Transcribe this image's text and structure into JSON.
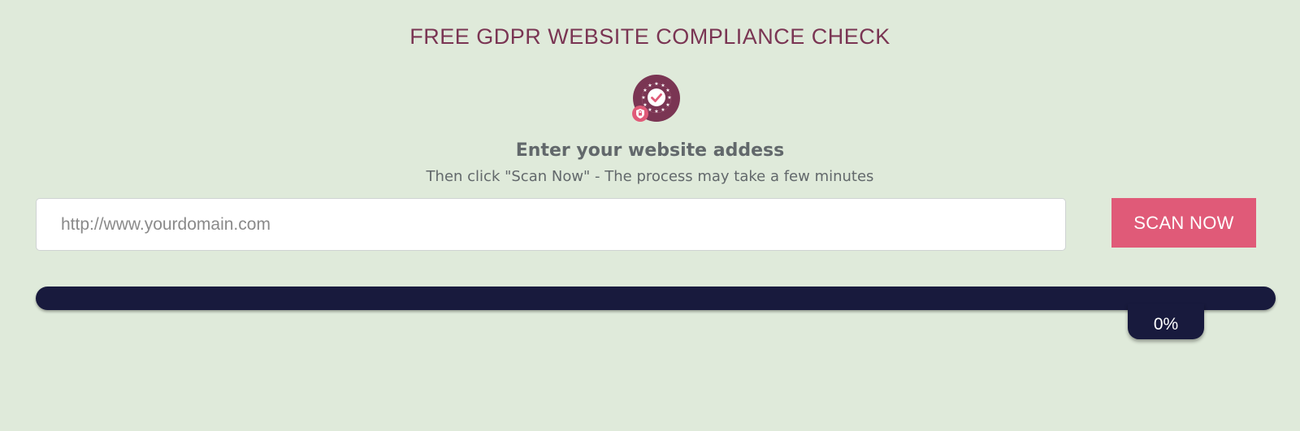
{
  "header": {
    "title": "FREE GDPR WEBSITE COMPLIANCE CHECK"
  },
  "badge": {
    "icon": "gdpr-shield-check-icon",
    "colors": {
      "circle": "#7a3553",
      "accent": "#e05a78"
    }
  },
  "form": {
    "heading": "Enter your website addess",
    "subheading": "Then click \"Scan Now\" - The process may take a few minutes",
    "url_input": {
      "value": "",
      "placeholder": "http://www.yourdomain.com"
    },
    "scan_button_label": "SCAN NOW"
  },
  "progress": {
    "percent": 0,
    "label": "0%"
  },
  "colors": {
    "background": "#dfeada",
    "title": "#7a3553",
    "button": "#e05a78",
    "progress_track": "#181a3d",
    "body_text": "#62686b"
  }
}
